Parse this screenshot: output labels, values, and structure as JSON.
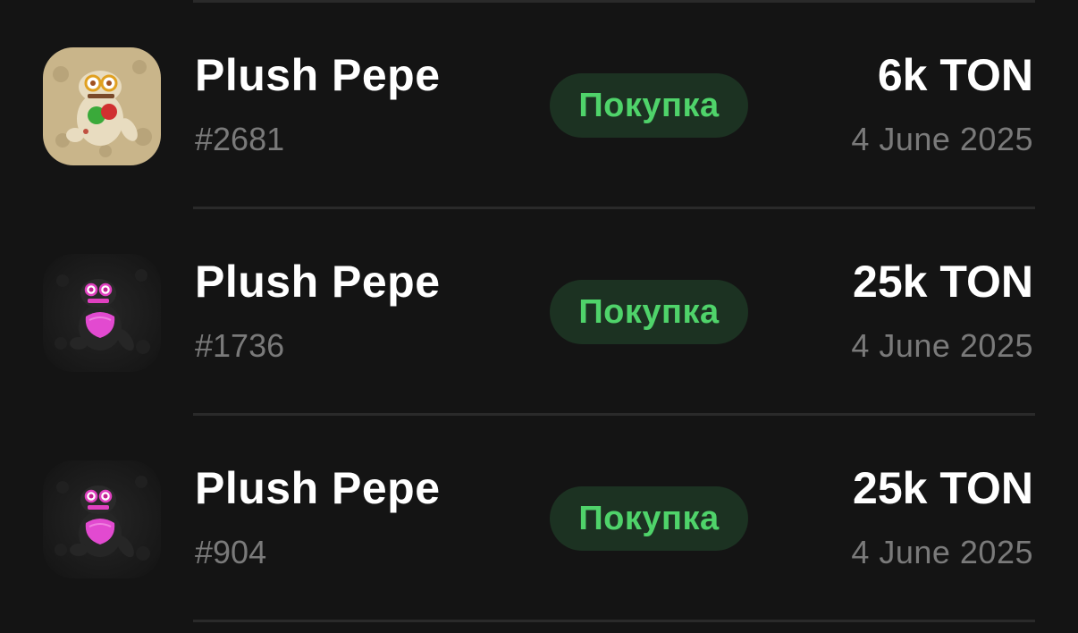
{
  "items": [
    {
      "title": "Plush Pepe",
      "number": "#2681",
      "status": "Покупка",
      "price": "6k TON",
      "date": "4 June 2025",
      "thumbnail": "plush-pepe-tan-icon"
    },
    {
      "title": "Plush Pepe",
      "number": "#1736",
      "status": "Покупка",
      "price": "25k TON",
      "date": "4 June 2025",
      "thumbnail": "plush-pepe-black-pink-icon"
    },
    {
      "title": "Plush Pepe",
      "number": "#904",
      "status": "Покупка",
      "price": "25k TON",
      "date": "4 June 2025",
      "thumbnail": "plush-pepe-black-pink-icon"
    }
  ],
  "colors": {
    "background": "#141414",
    "divider": "#2a2a2a",
    "badge_bg": "#1c3222",
    "badge_text": "#4fd36a",
    "secondary_text": "#7a7a7a"
  }
}
